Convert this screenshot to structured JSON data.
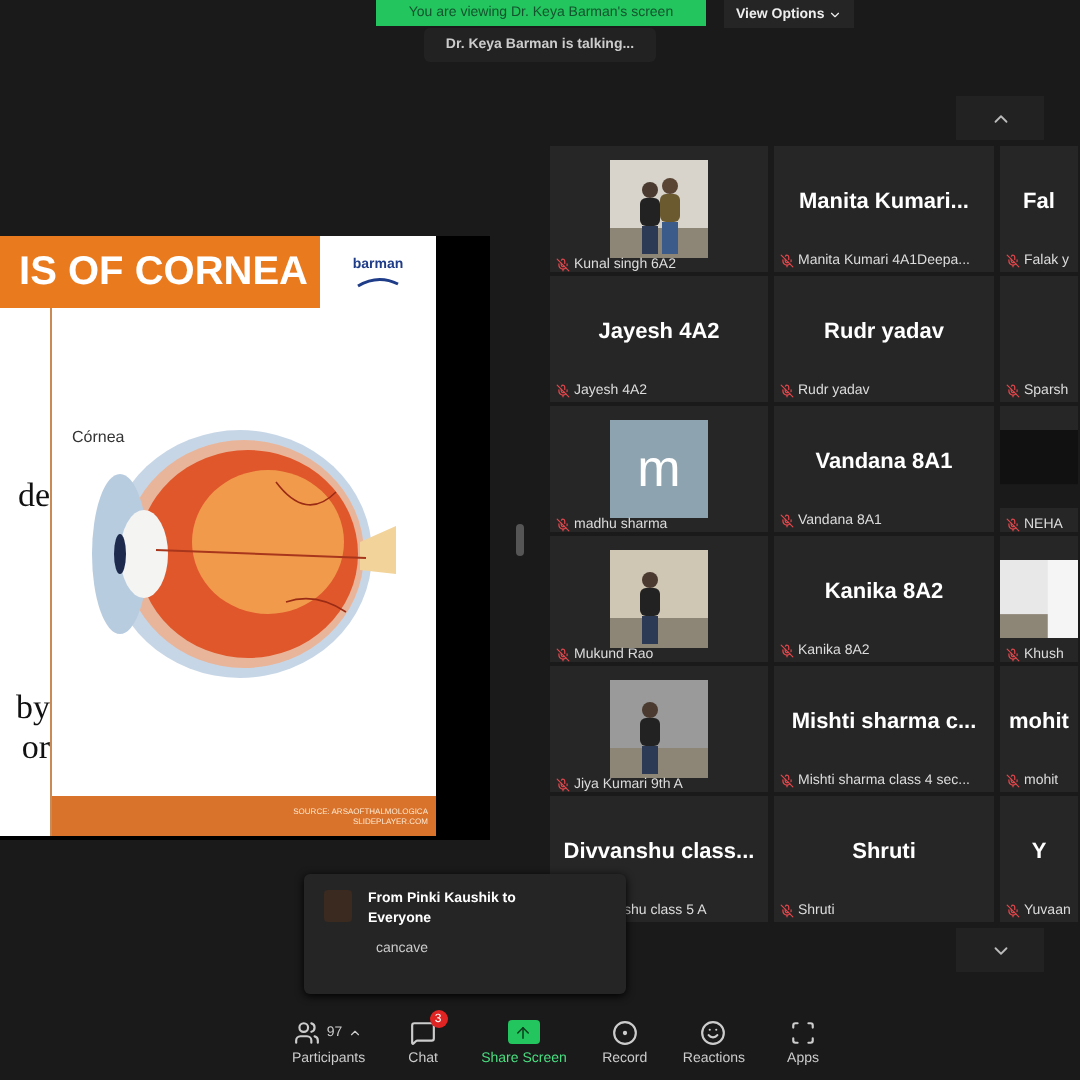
{
  "banner": {
    "text": "You are viewing Dr. Keya Barman's screen",
    "view_options": "View Options"
  },
  "talking": "Dr. Keya Barman is talking...",
  "slide": {
    "title": "IS OF CORNEA",
    "logo": "barman",
    "side_texts": [
      "de",
      "by",
      "or"
    ],
    "label": "Córnea",
    "source": [
      "SOURCE: ARSAOFTHALMOLOGICA",
      "SLIDEPLAYER.COM"
    ]
  },
  "tiles": [
    {
      "kind": "video",
      "label": "Kunal singh 6A2",
      "muted": true
    },
    {
      "kind": "name",
      "name": "Manita  Kumari...",
      "label": "Manita Kumari 4A1Deepa...",
      "muted": true
    },
    {
      "kind": "name",
      "name": "Fal",
      "label": "Falak y",
      "muted": true
    },
    {
      "kind": "name",
      "name": "Jayesh 4A2",
      "label": "Jayesh 4A2",
      "muted": true
    },
    {
      "kind": "name",
      "name": "Rudr yadav",
      "label": "Rudr yadav",
      "muted": true
    },
    {
      "kind": "blank",
      "label": "Sparsh",
      "muted": true
    },
    {
      "kind": "avatar",
      "name": "m",
      "label": "madhu sharma",
      "muted": true
    },
    {
      "kind": "name",
      "name": "Vandana 8A1",
      "label": "Vandana 8A1",
      "muted": true
    },
    {
      "kind": "video",
      "label": "NEHA",
      "muted": true
    },
    {
      "kind": "video",
      "label": "Mukund Rao",
      "muted": true
    },
    {
      "kind": "name",
      "name": "Kanika 8A2",
      "label": "Kanika 8A2",
      "muted": true
    },
    {
      "kind": "video",
      "label": "Khush",
      "muted": true
    },
    {
      "kind": "video",
      "label": "Jiya Kumari 9th A",
      "muted": true
    },
    {
      "kind": "name",
      "name": "Mishti  sharma  c...",
      "label": "Mishti sharma class 4 sec...",
      "muted": true
    },
    {
      "kind": "name",
      "name": "mohit",
      "label": "mohit",
      "muted": true
    },
    {
      "kind": "name",
      "name": "Divvanshu  class...",
      "label": "shu class 5 A",
      "muted": false
    },
    {
      "kind": "name",
      "name": "Shruti",
      "label": "Shruti",
      "muted": true
    },
    {
      "kind": "name",
      "name": "Y",
      "label": "Yuvaan",
      "muted": true
    }
  ],
  "toast": {
    "title": "From Pinki Kaushik to Everyone",
    "message": "cancave"
  },
  "toolbar": [
    {
      "kind": "participants",
      "label": "Participants",
      "count": "97"
    },
    {
      "kind": "chat",
      "label": "Chat",
      "badge": "3"
    },
    {
      "kind": "share",
      "label": "Share Screen"
    },
    {
      "kind": "record",
      "label": "Record"
    },
    {
      "kind": "reactions",
      "label": "Reactions"
    },
    {
      "kind": "apps",
      "label": "Apps"
    }
  ]
}
